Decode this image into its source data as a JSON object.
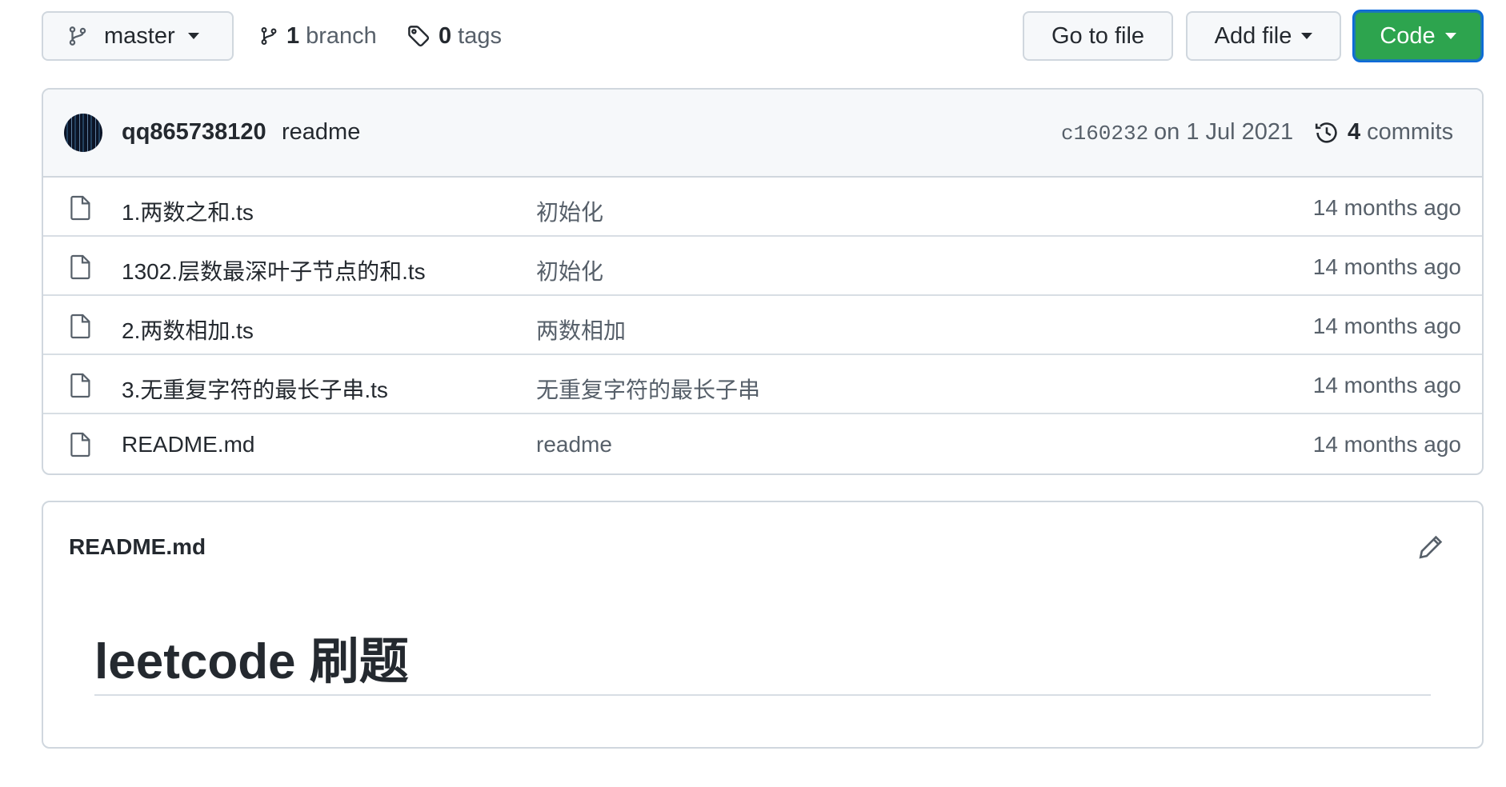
{
  "toolbar": {
    "branch_name": "master",
    "branches_count": "1",
    "branches_label": "branch",
    "tags_count": "0",
    "tags_label": "tags",
    "go_to_file": "Go to file",
    "add_file": "Add file",
    "code": "Code",
    "code_color": "#2da44e"
  },
  "commit": {
    "author": "qq865738120",
    "message": "readme",
    "sha": "c160232",
    "date": "on 1 Jul 2021",
    "commits_count": "4",
    "commits_label": "commits"
  },
  "files": [
    {
      "name": "1.两数之和.ts",
      "message": "初始化",
      "age": "14 months ago"
    },
    {
      "name": "1302.层数最深叶子节点的和.ts",
      "message": "初始化",
      "age": "14 months ago"
    },
    {
      "name": "2.两数相加.ts",
      "message": "两数相加",
      "age": "14 months ago"
    },
    {
      "name": "3.无重复字符的最长子串.ts",
      "message": "无重复字符的最长子串",
      "age": "14 months ago"
    },
    {
      "name": "README.md",
      "message": "readme",
      "age": "14 months ago"
    }
  ],
  "readme": {
    "filename": "README.md",
    "heading": "leetcode 刷题"
  },
  "icons": {
    "branch": "git-branch-icon",
    "tag": "tag-icon",
    "history": "history-icon",
    "file": "file-icon",
    "edit": "pencil-icon"
  }
}
